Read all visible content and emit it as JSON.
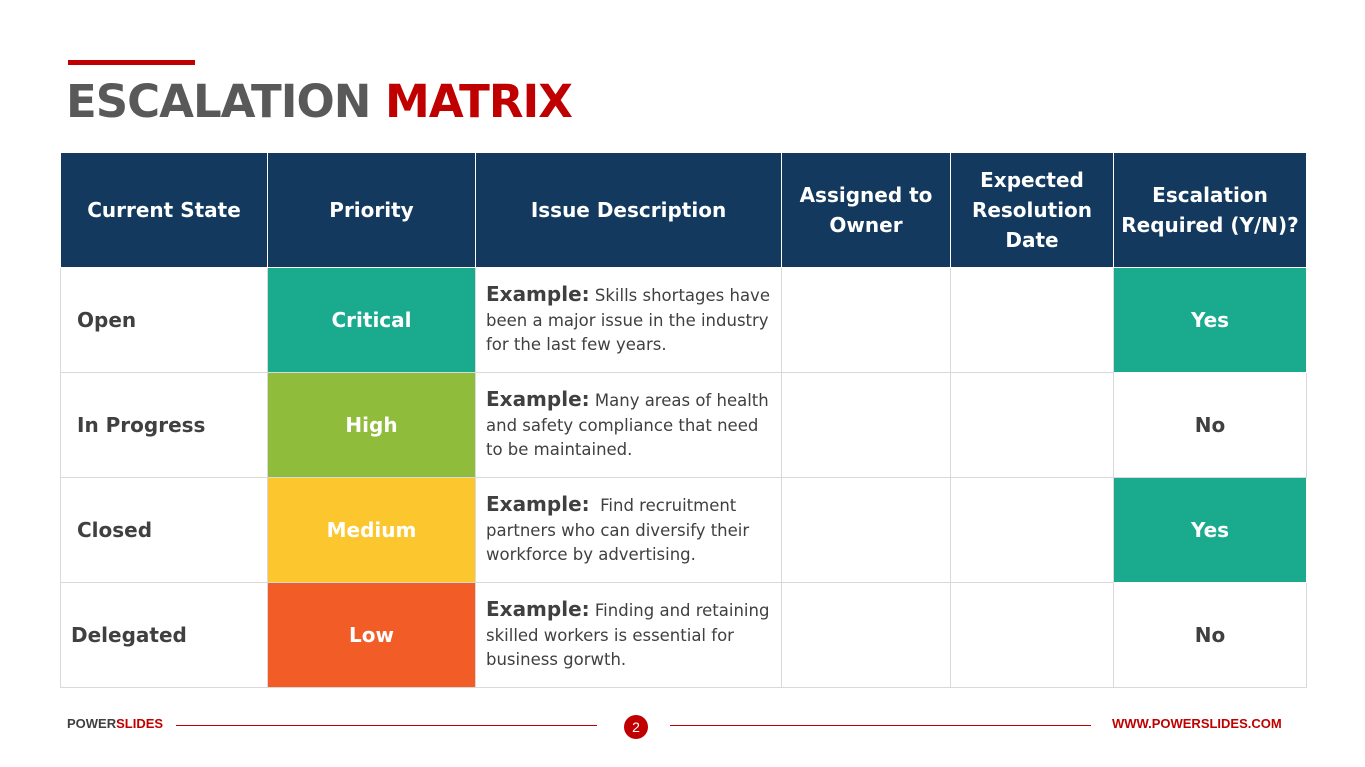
{
  "title": {
    "part1": "ESCALATION",
    "part2": "MATRIX"
  },
  "colors": {
    "brand_red": "#c00000",
    "header_navy": "#133a5e",
    "teal": "#1aab8f",
    "critical": "#1aab8f",
    "high": "#8fbc3b",
    "medium": "#fcc72e",
    "low": "#f25c27"
  },
  "table": {
    "headers": [
      "Current State",
      "Priority",
      "Issue Description",
      "Assigned to Owner",
      "Expected Resolution Date",
      "Escalation Required (Y/N)?"
    ],
    "rows": [
      {
        "state": "Open",
        "priority": "Critical",
        "example_label": "Example:",
        "description": " Skills shortages have been a major issue in the industry for the last few years.",
        "owner": "",
        "date": "",
        "escalation": "Yes"
      },
      {
        "state": "In Progress",
        "priority": "High",
        "example_label": "Example:",
        "description": " Many areas of health and safety compliance that need to be maintained.",
        "owner": "",
        "date": "",
        "escalation": "No"
      },
      {
        "state": "Closed",
        "priority": "Medium",
        "example_label": "Example:",
        "description": "  Find recruitment partners who can diversify their workforce by advertising.",
        "owner": "",
        "date": "",
        "escalation": "Yes"
      },
      {
        "state": "Delegated",
        "priority": "Low",
        "example_label": "Example:",
        "description": " Finding and retaining skilled workers is essential for business gorwth.",
        "owner": "",
        "date": "",
        "escalation": "No"
      }
    ]
  },
  "footer": {
    "brand_part1": "POWER",
    "brand_part2": "SLIDES",
    "page_number": "2",
    "url": "WWW.POWERSLIDES.COM"
  }
}
